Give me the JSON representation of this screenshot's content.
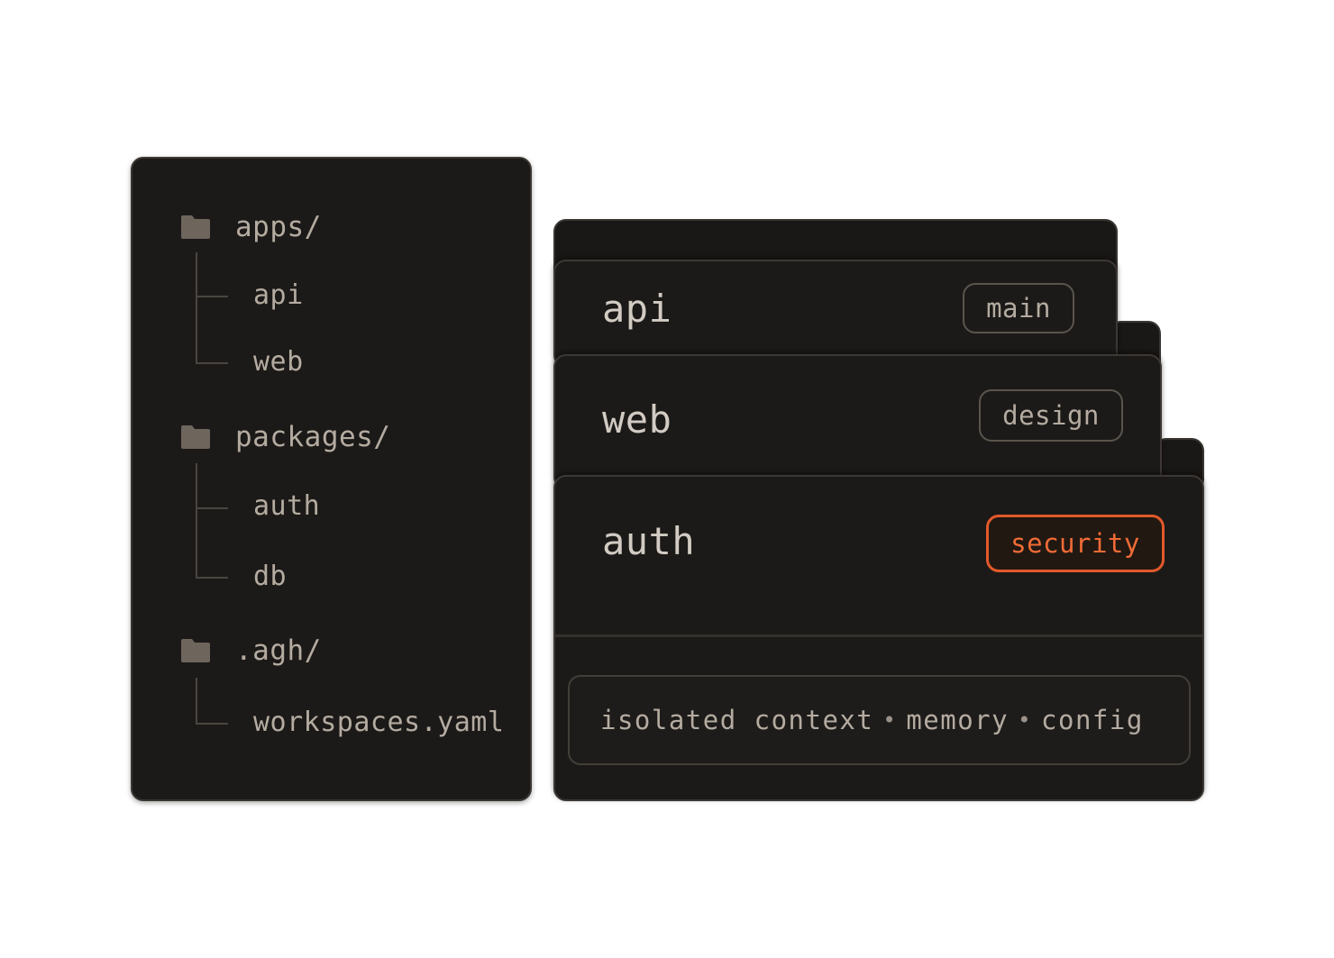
{
  "tree": {
    "groups": [
      {
        "folder": "apps/",
        "children": [
          "api",
          "web"
        ]
      },
      {
        "folder": "packages/",
        "children": [
          "auth",
          "db"
        ]
      },
      {
        "folder": ".agh/",
        "children": [
          "workspaces.yaml"
        ]
      }
    ]
  },
  "workspaces": {
    "cards": [
      {
        "title": "api",
        "tag": "main"
      },
      {
        "title": "web",
        "tag": "design"
      },
      {
        "title": "auth",
        "tag": "security"
      }
    ],
    "footer": {
      "items": [
        "isolated context",
        "memory",
        "config"
      ],
      "separator": "•"
    }
  },
  "colors": {
    "panel_bg": "#1c1a18",
    "text": "#b4aba1",
    "accent": "#e2592a"
  },
  "icons": {
    "folder": "folder-icon"
  }
}
